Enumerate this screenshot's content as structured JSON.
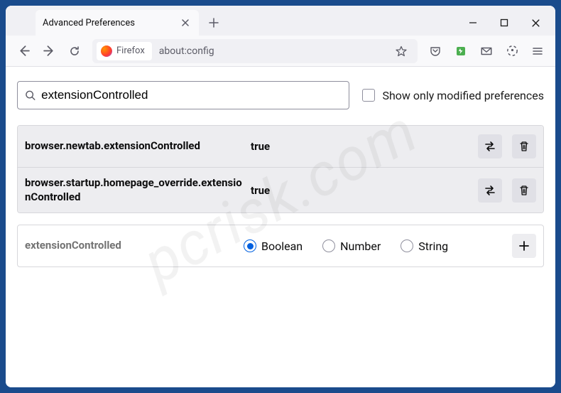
{
  "tab": {
    "title": "Advanced Preferences"
  },
  "url": {
    "identity_label": "Firefox",
    "path": "about:config"
  },
  "search": {
    "value": "extensionControlled",
    "checkbox_label": "Show only modified preferences"
  },
  "prefs": [
    {
      "name": "browser.newtab.extensionControlled",
      "value": "true"
    },
    {
      "name": "browser.startup.homepage_override.extensionControlled",
      "value": "true"
    }
  ],
  "new_pref": {
    "name": "extensionControlled",
    "types": [
      "Boolean",
      "Number",
      "String"
    ],
    "selected": "Boolean"
  }
}
